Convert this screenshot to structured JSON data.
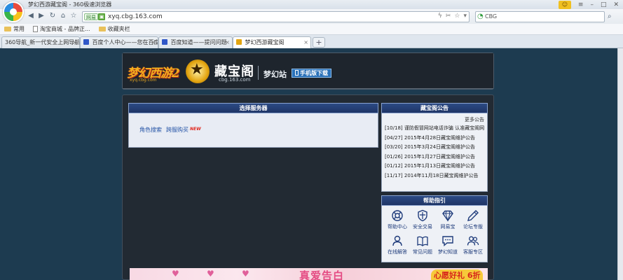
{
  "browser": {
    "window_title": "梦幻西游藏宝阁 - 360极速浏览器",
    "address": {
      "security_badge": "网易",
      "url": "xyq.cbg.163.com"
    },
    "search": {
      "text": "CBG"
    },
    "bookmarks": [
      {
        "label": "常用",
        "icon": "folder-icon"
      },
      {
        "label": "淘宝商城 - 品牌正...",
        "icon": "page-icon"
      },
      {
        "label": "收藏夹栏",
        "icon": "folder-icon"
      }
    ],
    "tabs": [
      {
        "label": "360导航_新一代安全上网导航",
        "color": "#2a8de0"
      },
      {
        "label": "百度个人中心——您在百度",
        "color": "#3057c7"
      },
      {
        "label": "百度知道——提问问题",
        "color": "#3057c7"
      },
      {
        "label": "梦幻西游藏宝阁",
        "color": "#e3a511",
        "active": true
      }
    ],
    "new_tab_symbol": "+"
  },
  "header": {
    "game_logo": "梦幻西游2",
    "game_domain": "xyq.cbg.com",
    "site_title": "藏宝阁",
    "site_domain": "cbg.163.com",
    "site_name": "梦幻站",
    "mobile_button": "手机版下载"
  },
  "server_panel": {
    "title": "选择服务器",
    "links": [
      "角色搜索",
      "跨服购买"
    ],
    "new_badge": "NEW"
  },
  "notice_panel": {
    "title": "藏宝阁公告",
    "more": "更多公告",
    "items": [
      "[10/18] 谨防假冒网站电话诈骗 认准藏宝阁网站",
      "[04/27] 2015年4月28日藏宝阁维护公告",
      "[03/20] 2015年3月24日藏宝阁维护公告",
      "[01/26] 2015年1月27日藏宝阁维护公告",
      "[01/12] 2015年1月13日藏宝阁维护公告",
      "[11/17] 2014年11月18日藏宝阁维护公告"
    ]
  },
  "help_panel": {
    "title": "帮助指引",
    "items": [
      {
        "label": "帮助中心",
        "icon": "lifebuoy-icon"
      },
      {
        "label": "安全交易",
        "icon": "shield-icon"
      },
      {
        "label": "网易宝",
        "icon": "diamond-icon"
      },
      {
        "label": "论坛专版",
        "icon": "pen-icon"
      },
      {
        "label": "在线解答",
        "icon": "person-icon"
      },
      {
        "label": "常见问题",
        "icon": "book-icon"
      },
      {
        "label": "梦幻知道",
        "icon": "chat-icon"
      },
      {
        "label": "客服专区",
        "icon": "users-icon"
      }
    ]
  },
  "banner": {
    "headline": "真爱告白",
    "tag": "心愿好礼 6折"
  },
  "colors": {
    "page_bg": "#1d3b50",
    "panel_header": "#2c4a84",
    "link": "#2453a6",
    "accent_gold": "#f3b01f"
  }
}
